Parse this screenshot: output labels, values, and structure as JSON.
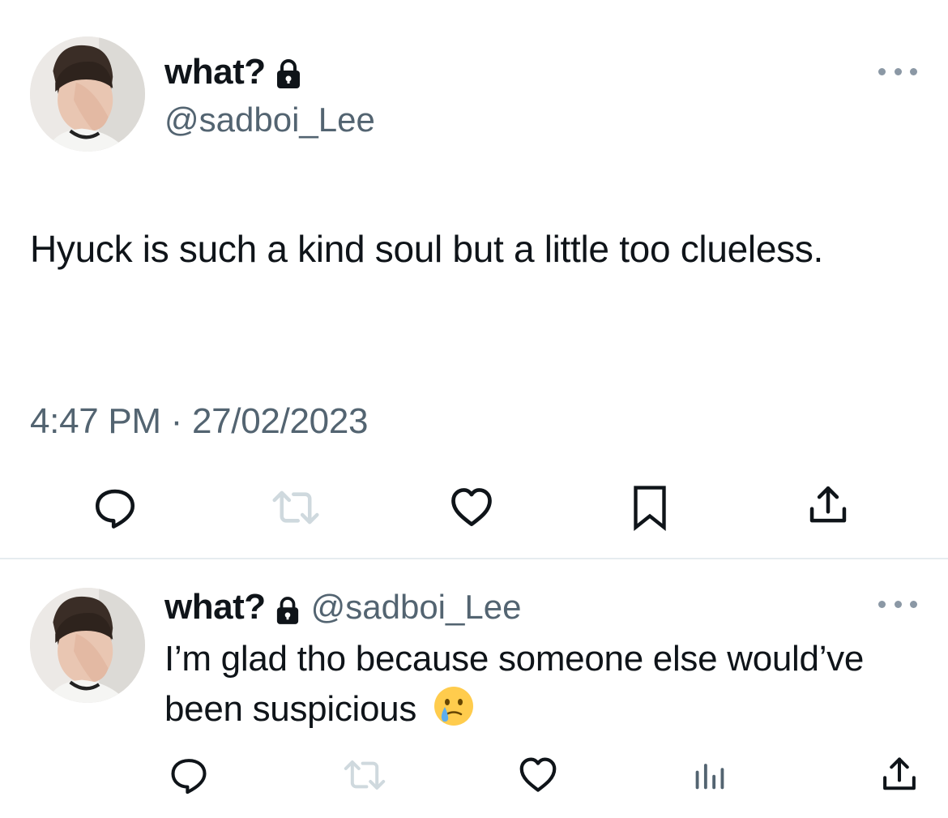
{
  "tweet": {
    "display_name": "what?",
    "handle": "@sadboi_Lee",
    "text": "Hyuck is such a kind soul but a little too clueless.",
    "timestamp": "4:47 PM · 27/02/2023"
  },
  "reply": {
    "display_name": "what?",
    "handle": "@sadboi_Lee",
    "text": "I’m glad tho because someone else would’ve been suspicious",
    "emoji": "crying-face-with-tear"
  },
  "icons": {
    "reply": "reply-icon",
    "retweet": "retweet-icon",
    "like": "heart-icon",
    "bookmark": "bookmark-icon",
    "share": "share-icon",
    "views": "views-icon",
    "more": "more-icon",
    "lock": "lock-icon"
  },
  "colors": {
    "text": "#0f1419",
    "secondary": "#536471",
    "icon": "#536471",
    "disabled_icon": "#cfd9de",
    "divider": "#e6ecf0"
  }
}
